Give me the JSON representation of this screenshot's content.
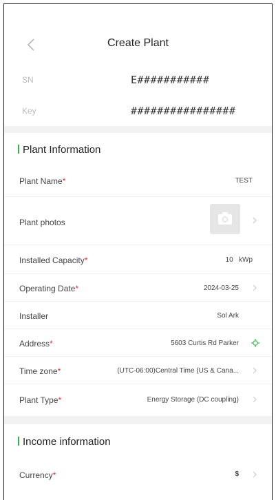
{
  "header": {
    "title": "Create Plant",
    "sn_label": "SN",
    "sn_value": "E###########",
    "key_label": "Key",
    "key_value": "################"
  },
  "plant_info": {
    "section_title": "Plant Information",
    "fields": {
      "plant_name": {
        "label": "Plant Name",
        "value": "TEST"
      },
      "plant_photos": {
        "label": "Plant photos"
      },
      "installed_capacity": {
        "label": "Installed Capacity",
        "value": "10",
        "unit": "kWp"
      },
      "operating_date": {
        "label": "Operating Date",
        "value": "2024-03-25"
      },
      "installer": {
        "label": "Installer",
        "value": "Sol Ark"
      },
      "address": {
        "label": "Address",
        "value": "5603 Curtis Rd Parker"
      },
      "time_zone": {
        "label": "Time zone",
        "value": "(UTC-06:00)Central Time (US & Cana..."
      },
      "plant_type": {
        "label": "Plant Type",
        "value": "Energy Storage (DC coupling)"
      }
    }
  },
  "income_info": {
    "section_title": "Income information",
    "fields": {
      "currency": {
        "label": "Currency",
        "value": "$"
      }
    }
  },
  "colors": {
    "accent": "#37b24d",
    "required": "#e03131",
    "separator": "#f2f2f2"
  },
  "icons": [
    "back-arrow-icon",
    "camera-icon",
    "chevron-right-icon",
    "location-icon"
  ]
}
